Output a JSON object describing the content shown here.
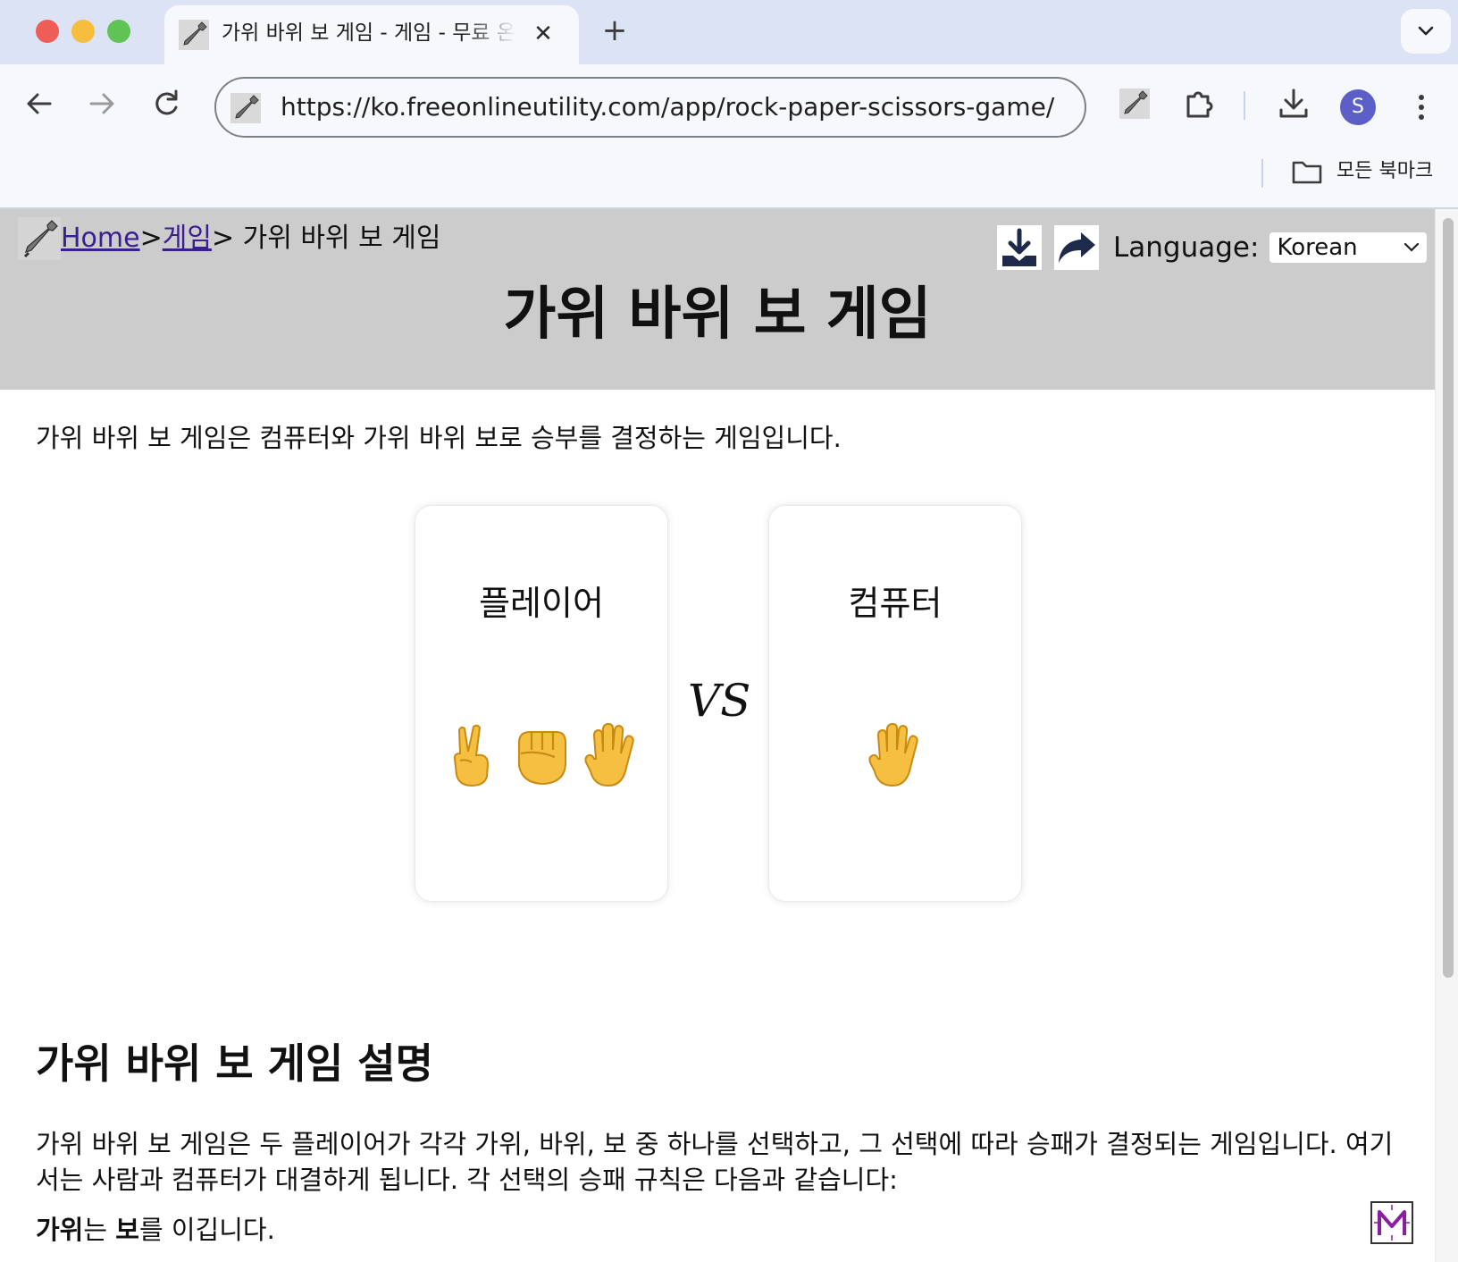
{
  "browser": {
    "tab_title": "가위 바위 보 게임 - 게임 - 무료 온라인",
    "tab_close": "✕",
    "new_tab": "+",
    "url": "https://ko.freeonlineutility.com/app/rock-paper-scissors-game/",
    "avatar_letter": "S",
    "bookmarks_label": "모든 북마크"
  },
  "header": {
    "breadcrumb": {
      "home": "Home",
      "sep1": ">",
      "category": "게임",
      "sep2": ">",
      "current": " 가위 바위 보 게임"
    },
    "language_label": "Language:",
    "language_selected": "Korean",
    "page_title": "가위 바위 보 게임"
  },
  "main": {
    "intro": "가위 바위 보 게임은 컴퓨터와 가위 바위 보로 승부를 결정하는 게임입니다.",
    "player_card": {
      "title": "플레이어",
      "choices": [
        "victory-hand",
        "raised-fist",
        "raised-hand"
      ]
    },
    "vs": "VS",
    "computer_card": {
      "title": "컴퓨터",
      "choice": "raised-hand"
    },
    "section_title": "가위 바위 보 게임 설명",
    "description": "가위 바위 보 게임은 두 플레이어가 각각 가위, 바위, 보 중 하나를 선택하고, 그 선택에 따라 승패가 결정되는 게임입니다. 여기서는 사람과 컴퓨터가 대결하게 됩니다. 각 선택의 승패 규칙은 다음과 같습니다:",
    "rule1": {
      "a": "가위",
      "b": "는 ",
      "c": "보",
      "d": "를 이깁니다."
    }
  },
  "colors": {
    "hero_bg": "#cccccc",
    "link": "#3a1f8f",
    "emoji_yellow": "#f5c042",
    "avatar": "#5b5fc7"
  }
}
